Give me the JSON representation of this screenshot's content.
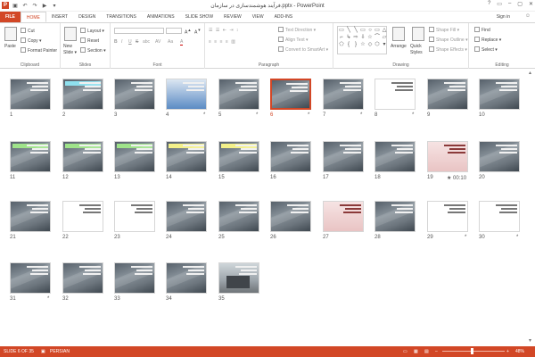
{
  "title": "فرآیند هوشمندسازی در سازمان.pptx - PowerPoint",
  "window_controls": [
    "?",
    "▭",
    "–",
    "▢",
    "✕"
  ],
  "tabs": [
    "FILE",
    "HOME",
    "INSERT",
    "DESIGN",
    "TRANSITIONS",
    "ANIMATIONS",
    "SLIDE SHOW",
    "REVIEW",
    "VIEW",
    "ADD-INS"
  ],
  "active_tab": "HOME",
  "sign_in": "Sign in",
  "ribbon": {
    "clipboard": {
      "paste": "Paste",
      "cut": "Cut",
      "copy": "Copy ▾",
      "format_painter": "Format Painter",
      "label": "Clipboard"
    },
    "slides": {
      "new_slide": "New Slide ▾",
      "layout": "Layout ▾",
      "reset": "Reset",
      "section": "Section ▾",
      "label": "Slides"
    },
    "font": {
      "label": "Font",
      "bold": "B",
      "italic": "I",
      "underline": "U",
      "strike": "S",
      "shadow": "abc",
      "spacing": "AV",
      "case": "Aa",
      "color": "A"
    },
    "paragraph": {
      "text_direction": "Text Direction ▾",
      "align_text": "Align Text ▾",
      "convert": "Convert to SmartArt ▾",
      "label": "Paragraph"
    },
    "drawing": {
      "arrange": "Arrange",
      "quick_styles": "Quick Styles",
      "shape_fill": "Shape Fill ▾",
      "shape_outline": "Shape Outline ▾",
      "shape_effects": "Shape Effects ▾",
      "label": "Drawing"
    },
    "editing": {
      "find": "Find",
      "replace": "Replace ▾",
      "select": "Select ▾",
      "label": "Editing"
    }
  },
  "slides": [
    {
      "num": "1",
      "style": "dark"
    },
    {
      "num": "2",
      "style": "dark",
      "highlight": "cyan"
    },
    {
      "num": "3",
      "style": "dark"
    },
    {
      "num": "4",
      "style": "blue",
      "star": "*"
    },
    {
      "num": "5",
      "style": "dark",
      "star": "*"
    },
    {
      "num": "6",
      "style": "dark",
      "star": "*",
      "selected": true
    },
    {
      "num": "7",
      "style": "dark",
      "star": "*"
    },
    {
      "num": "8",
      "style": "white",
      "star": "*"
    },
    {
      "num": "9",
      "style": "dark"
    },
    {
      "num": "10",
      "style": "dark"
    },
    {
      "num": "11",
      "style": "dark",
      "highlight": "green"
    },
    {
      "num": "12",
      "style": "dark",
      "highlight": "green"
    },
    {
      "num": "13",
      "style": "dark",
      "highlight": "green"
    },
    {
      "num": "14",
      "style": "dark",
      "highlight": "yellow"
    },
    {
      "num": "15",
      "style": "dark",
      "highlight": "yellow"
    },
    {
      "num": "16",
      "style": "dark"
    },
    {
      "num": "17",
      "style": "dark"
    },
    {
      "num": "18",
      "style": "dark"
    },
    {
      "num": "19",
      "style": "pink",
      "star": "★ 00:10"
    },
    {
      "num": "20",
      "style": "dark"
    },
    {
      "num": "21",
      "style": "dark"
    },
    {
      "num": "22",
      "style": "white"
    },
    {
      "num": "23",
      "style": "white"
    },
    {
      "num": "24",
      "style": "dark"
    },
    {
      "num": "25",
      "style": "dark"
    },
    {
      "num": "26",
      "style": "dark"
    },
    {
      "num": "27",
      "style": "pink"
    },
    {
      "num": "28",
      "style": "dark"
    },
    {
      "num": "29",
      "style": "white",
      "star": "*"
    },
    {
      "num": "30",
      "style": "white",
      "star": "*"
    },
    {
      "num": "31",
      "style": "dark",
      "star": "*"
    },
    {
      "num": "32",
      "style": "dark"
    },
    {
      "num": "33",
      "style": "dark"
    },
    {
      "num": "34",
      "style": "dark"
    },
    {
      "num": "35",
      "style": "photo"
    }
  ],
  "status": {
    "slide": "SLIDE 6 OF 35",
    "language": "PERSIAN",
    "zoom": "48%"
  }
}
